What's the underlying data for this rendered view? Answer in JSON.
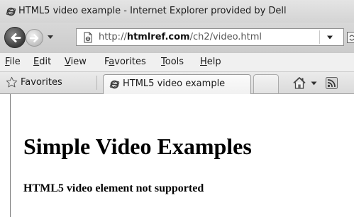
{
  "window": {
    "title": "HTML5 video example - Internet Explorer provided by Dell"
  },
  "address_bar": {
    "url_prefix": "http://",
    "url_domain": "htmlref.com",
    "url_path": "/ch2/video.html"
  },
  "menu": {
    "items": [
      {
        "accel": "F",
        "rest": "ile"
      },
      {
        "accel": "E",
        "rest": "dit"
      },
      {
        "accel": "V",
        "rest": "iew"
      },
      {
        "pre": "F",
        "accel": "a",
        "rest": "vorites"
      },
      {
        "accel": "T",
        "rest": "ools"
      },
      {
        "accel": "H",
        "rest": "elp"
      }
    ]
  },
  "favorites_bar": {
    "favorites_label": "Favorites",
    "tab_label": "HTML5 video example"
  },
  "page": {
    "heading": "Simple Video Examples",
    "message": "HTML5 video element not supported"
  },
  "icons": {
    "title": "ie-logo-icon",
    "back": "back-arrow-icon",
    "forward": "forward-arrow-icon",
    "page": "page-icon",
    "refresh": "refresh-icon",
    "favorites": "star-icon",
    "home": "home-icon",
    "feeds": "feeds-icon"
  }
}
